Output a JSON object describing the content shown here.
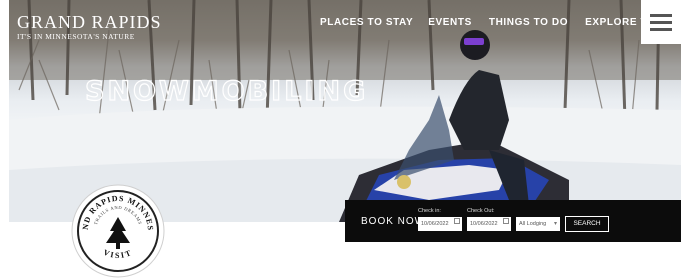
{
  "header": {
    "logo_name": "GRAND RAPIDS",
    "logo_tagline": "IT'S IN MINNESOTA'S NATURE",
    "nav_items": [
      "PLACES TO STAY",
      "EVENTS",
      "THINGS TO DO",
      "EXPLORE THE OUTDOORS"
    ],
    "menu_icon": "hamburger-menu-icon"
  },
  "hero": {
    "headline": "SNOWMOBILING"
  },
  "booking": {
    "book_now_label": "BOOK NOW",
    "checkin_label": "Check in:",
    "checkout_label": "Check Out:",
    "checkin_value": "10/06/2022",
    "checkout_value": "10/06/2022",
    "guests_value": "All Lodging",
    "search_label": "SEARCH"
  },
  "seal": {
    "text_top": "GRAND RAPIDS MINNESOTA",
    "text_inner": "TRAILS AND DREAMS",
    "text_bottom": "VISIT"
  },
  "colors": {
    "booking_bg": "#0c0c0c",
    "nav_text": "#ffffff",
    "snowmobile_blue": "#2742a8"
  }
}
